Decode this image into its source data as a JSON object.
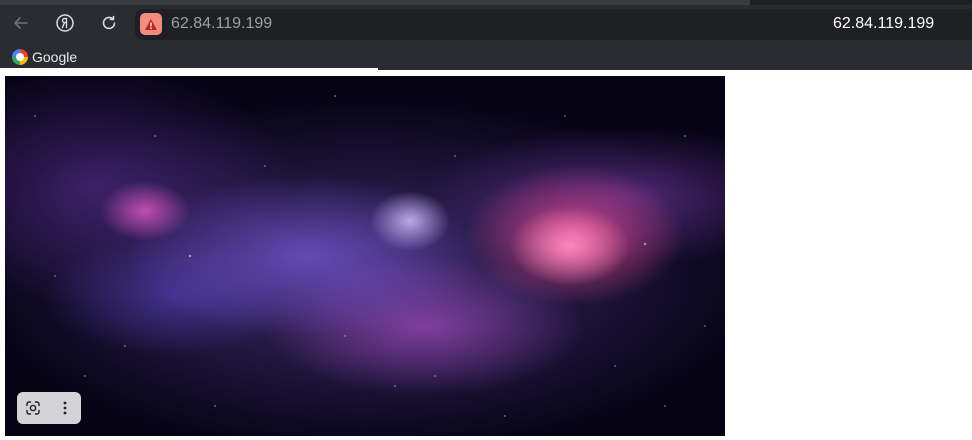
{
  "browser": {
    "address_url": "62.84.119.199",
    "page_title": "62.84.119.199",
    "security_icon": "warning-triangle-icon",
    "colors": {
      "toolbar_bg": "#2b2c31",
      "omnibox_bg": "#1f2024",
      "warning_badge": "#f28b82"
    }
  },
  "bookmarks": [
    {
      "label": "Google",
      "icon": "google-icon"
    }
  ],
  "image_overlay": {
    "buttons": [
      {
        "icon": "camera-search-icon"
      },
      {
        "icon": "more-vertical-icon"
      }
    ]
  }
}
